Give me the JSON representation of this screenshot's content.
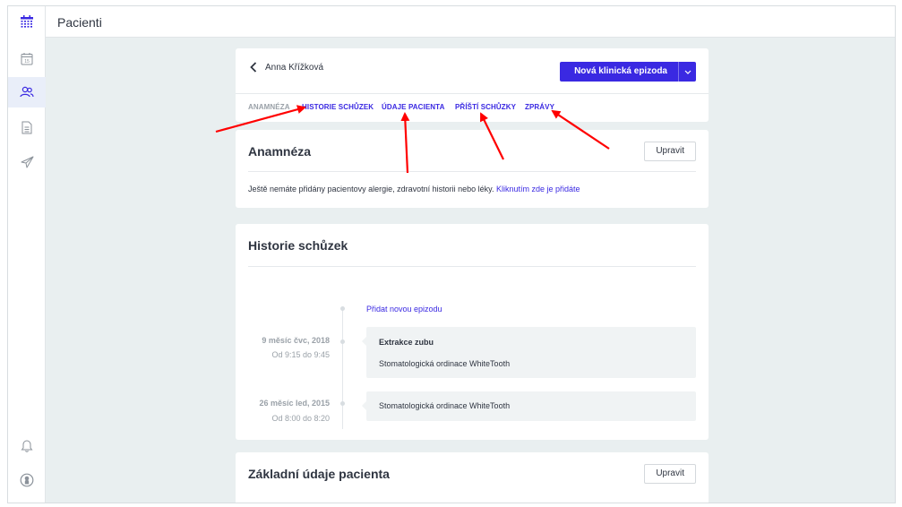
{
  "colors": {
    "accent": "#3a29e2",
    "arrow": "#ff0000",
    "background": "#e9eff0"
  },
  "sidebar": {
    "items": [
      {
        "icon": "calendar-grid-icon",
        "active": false
      },
      {
        "icon": "calendar-day-icon",
        "active": false
      },
      {
        "icon": "users-icon",
        "active": true
      },
      {
        "icon": "document-icon",
        "active": false
      },
      {
        "icon": "send-icon",
        "active": false
      },
      {
        "icon": "bell-icon",
        "active": false
      },
      {
        "icon": "account-icon",
        "active": false
      }
    ]
  },
  "topbar": {
    "title": "Pacienti"
  },
  "patient": {
    "back_icon": "chevron-left-icon",
    "name": "Anna Křížková",
    "primary_button": "Nová klinická epizoda",
    "primary_caret_icon": "chevron-down-icon"
  },
  "tabs": [
    {
      "label": "ANAMNÉZA",
      "active": false
    },
    {
      "label": "HISTORIE SCHŮZEK",
      "active": true
    },
    {
      "label": "ÚDAJE PACIENTA",
      "active": true
    },
    {
      "label": "PŘÍŠTÍ SCHŮZKY",
      "active": true
    },
    {
      "label": "ZPRÁVY",
      "active": true
    }
  ],
  "anamneza": {
    "title": "Anamnéza",
    "edit_button": "Upravit",
    "text": "Ještě nemáte přidány pacientovy alergie, zdravotní historii nebo léky.",
    "link": "Kliknutím zde je přidáte"
  },
  "historie": {
    "title": "Historie schůzek",
    "add_link": "Přidat novou epizodu",
    "entries": [
      {
        "date": "9 měsíc čvc, 2018",
        "time": "Od 9:15 do 9:45",
        "title": "Extrakce zubu",
        "clinic": "Stomatologická ordinace WhiteTooth"
      },
      {
        "date": "26 měsíc led, 2015",
        "time": "Od 8:00 do 8:20",
        "title": "",
        "clinic": "Stomatologická ordinace WhiteTooth"
      }
    ]
  },
  "zakladni": {
    "title": "Základní údaje pacienta",
    "edit_button": "Upravit"
  }
}
